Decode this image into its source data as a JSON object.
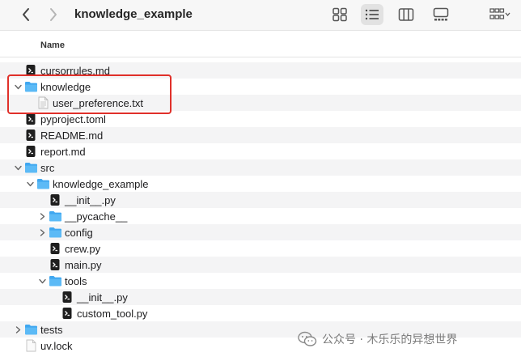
{
  "window": {
    "title": "knowledge_example"
  },
  "column_header": {
    "name": "Name"
  },
  "rows": [
    {
      "name": "cursorrules.md",
      "type": "file-dark",
      "depth": 0,
      "expand": "none"
    },
    {
      "name": "knowledge",
      "type": "folder",
      "depth": 0,
      "expand": "open"
    },
    {
      "name": "user_preference.txt",
      "type": "file-text",
      "depth": 1,
      "expand": "none"
    },
    {
      "name": "pyproject.toml",
      "type": "file-dark",
      "depth": 0,
      "expand": "none"
    },
    {
      "name": "README.md",
      "type": "file-dark",
      "depth": 0,
      "expand": "none"
    },
    {
      "name": "report.md",
      "type": "file-dark",
      "depth": 0,
      "expand": "none"
    },
    {
      "name": "src",
      "type": "folder",
      "depth": 0,
      "expand": "open"
    },
    {
      "name": "knowledge_example",
      "type": "folder",
      "depth": 1,
      "expand": "open"
    },
    {
      "name": "__init__.py",
      "type": "file-dark",
      "depth": 2,
      "expand": "none"
    },
    {
      "name": "__pycache__",
      "type": "folder",
      "depth": 2,
      "expand": "closed"
    },
    {
      "name": "config",
      "type": "folder",
      "depth": 2,
      "expand": "closed"
    },
    {
      "name": "crew.py",
      "type": "file-dark",
      "depth": 2,
      "expand": "none"
    },
    {
      "name": "main.py",
      "type": "file-dark",
      "depth": 2,
      "expand": "none"
    },
    {
      "name": "tools",
      "type": "folder",
      "depth": 2,
      "expand": "open"
    },
    {
      "name": "__init__.py",
      "type": "file-dark",
      "depth": 3,
      "expand": "none"
    },
    {
      "name": "custom_tool.py",
      "type": "file-dark",
      "depth": 3,
      "expand": "none"
    },
    {
      "name": "tests",
      "type": "folder",
      "depth": 0,
      "expand": "closed"
    },
    {
      "name": "uv.lock",
      "type": "file-blank",
      "depth": 0,
      "expand": "none"
    }
  ],
  "watermark": {
    "text": "公众号 · 木乐乐的异想世界"
  },
  "colors": {
    "folder": "#3fa7f0",
    "highlight": "#e0302a",
    "toolbar_bg": "#f7f7f7"
  }
}
